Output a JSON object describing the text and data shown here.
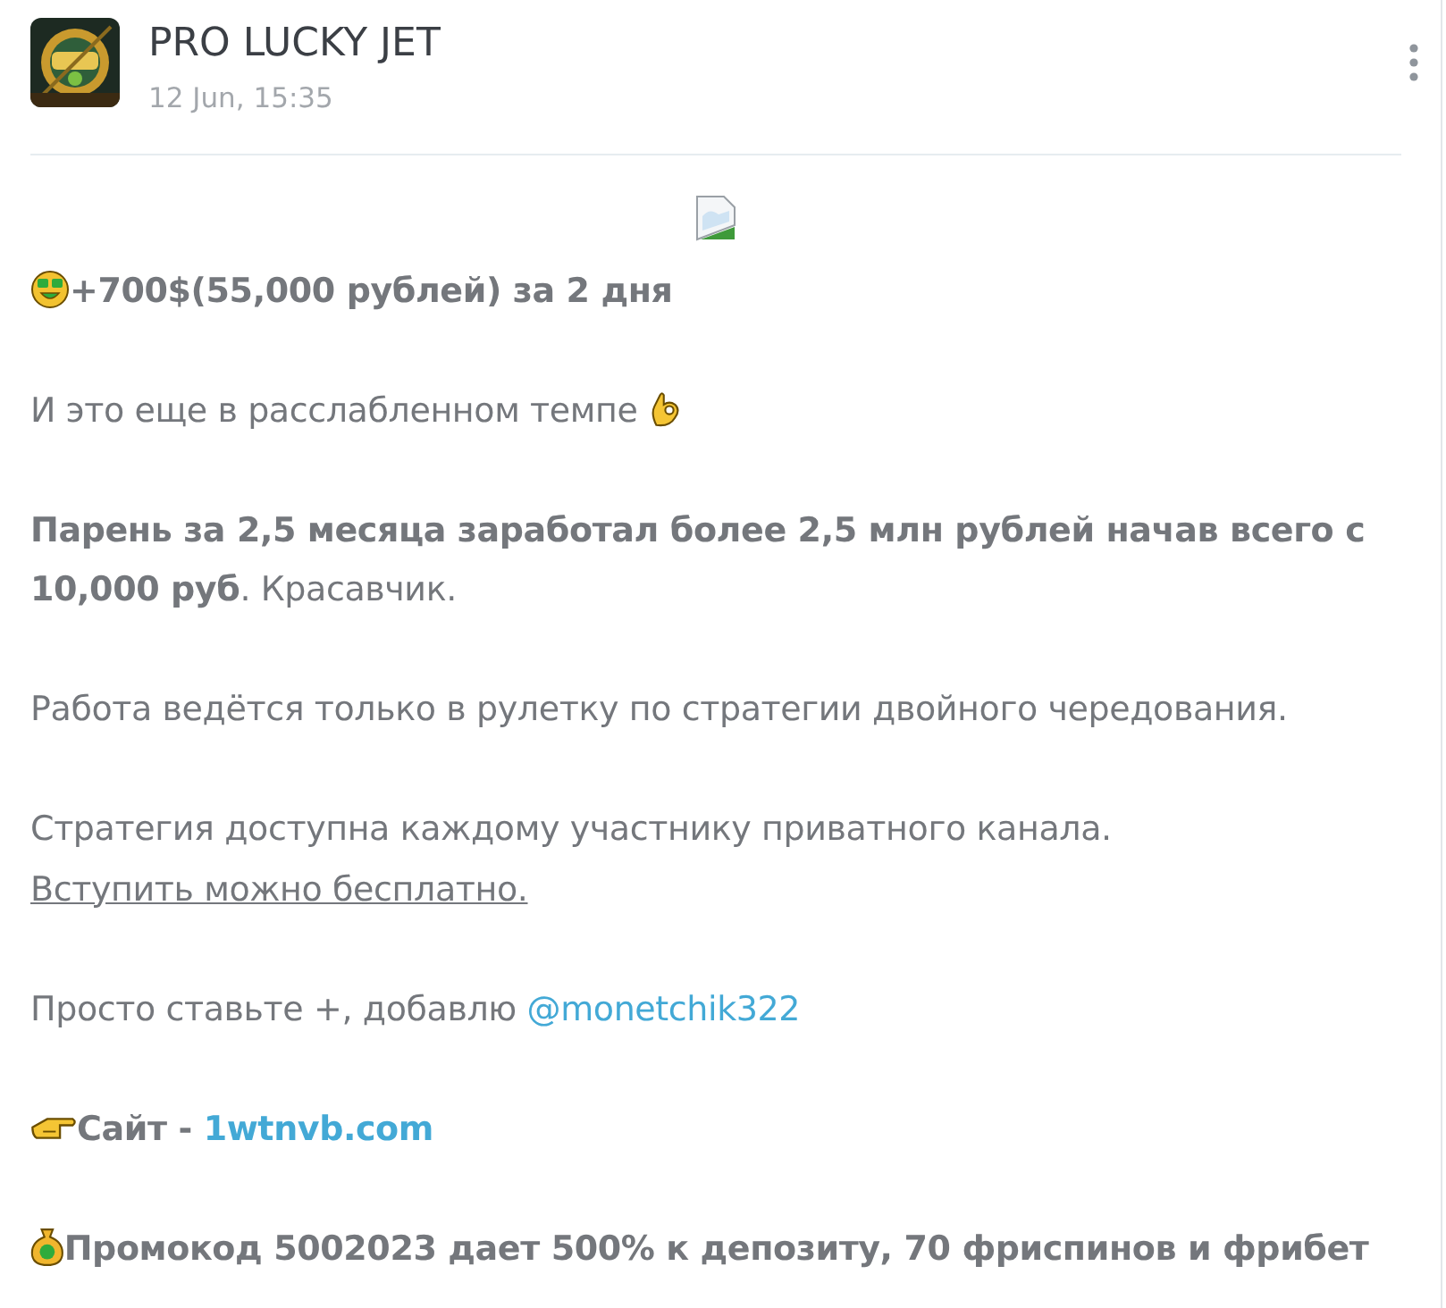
{
  "channel": {
    "name": "PRO LUCKY JET",
    "date": "12 Jun, 15:35"
  },
  "post": {
    "image": {
      "kind": "broken"
    },
    "paragraphs": [
      {
        "kind": "moneyface",
        "bold": true,
        "text": "+700$(55,000 рублей) за 2 дня"
      },
      {
        "kind": "okhand",
        "bold": false,
        "text": "И это еще в расслабленном темпе "
      },
      {
        "kind": "plain",
        "bold": false,
        "text": "**Парень за 2,5 месяца заработал более 2,5 млн рублей начав всего с 10,000 руб**. Красавчик."
      },
      {
        "kind": "plain",
        "bold": false,
        "text": "Работа ведётся только в рулетку по стратегии двойного чередования."
      },
      {
        "kind": "plain",
        "bold": false,
        "text": "Стратегия доступна каждому участнику приватного канала. ",
        "link": {
          "kind": "underline",
          "text": "Вступить можно бесплатно."
        }
      },
      {
        "kind": "plain",
        "bold": false,
        "text": "Просто ставьте +, добавлю ",
        "link": {
          "kind": "blue",
          "text": "@monetchik322"
        }
      },
      {
        "kind": "pointer",
        "bold": true,
        "text": "Сайт - ",
        "link": {
          "kind": "blue",
          "text": "1wtnvb.com"
        }
      },
      {
        "kind": "moneybag",
        "bold": true,
        "text": "Промокод 5002023 дает 500% к депозиту, 70 фриспинов и фрибет"
      }
    ]
  }
}
